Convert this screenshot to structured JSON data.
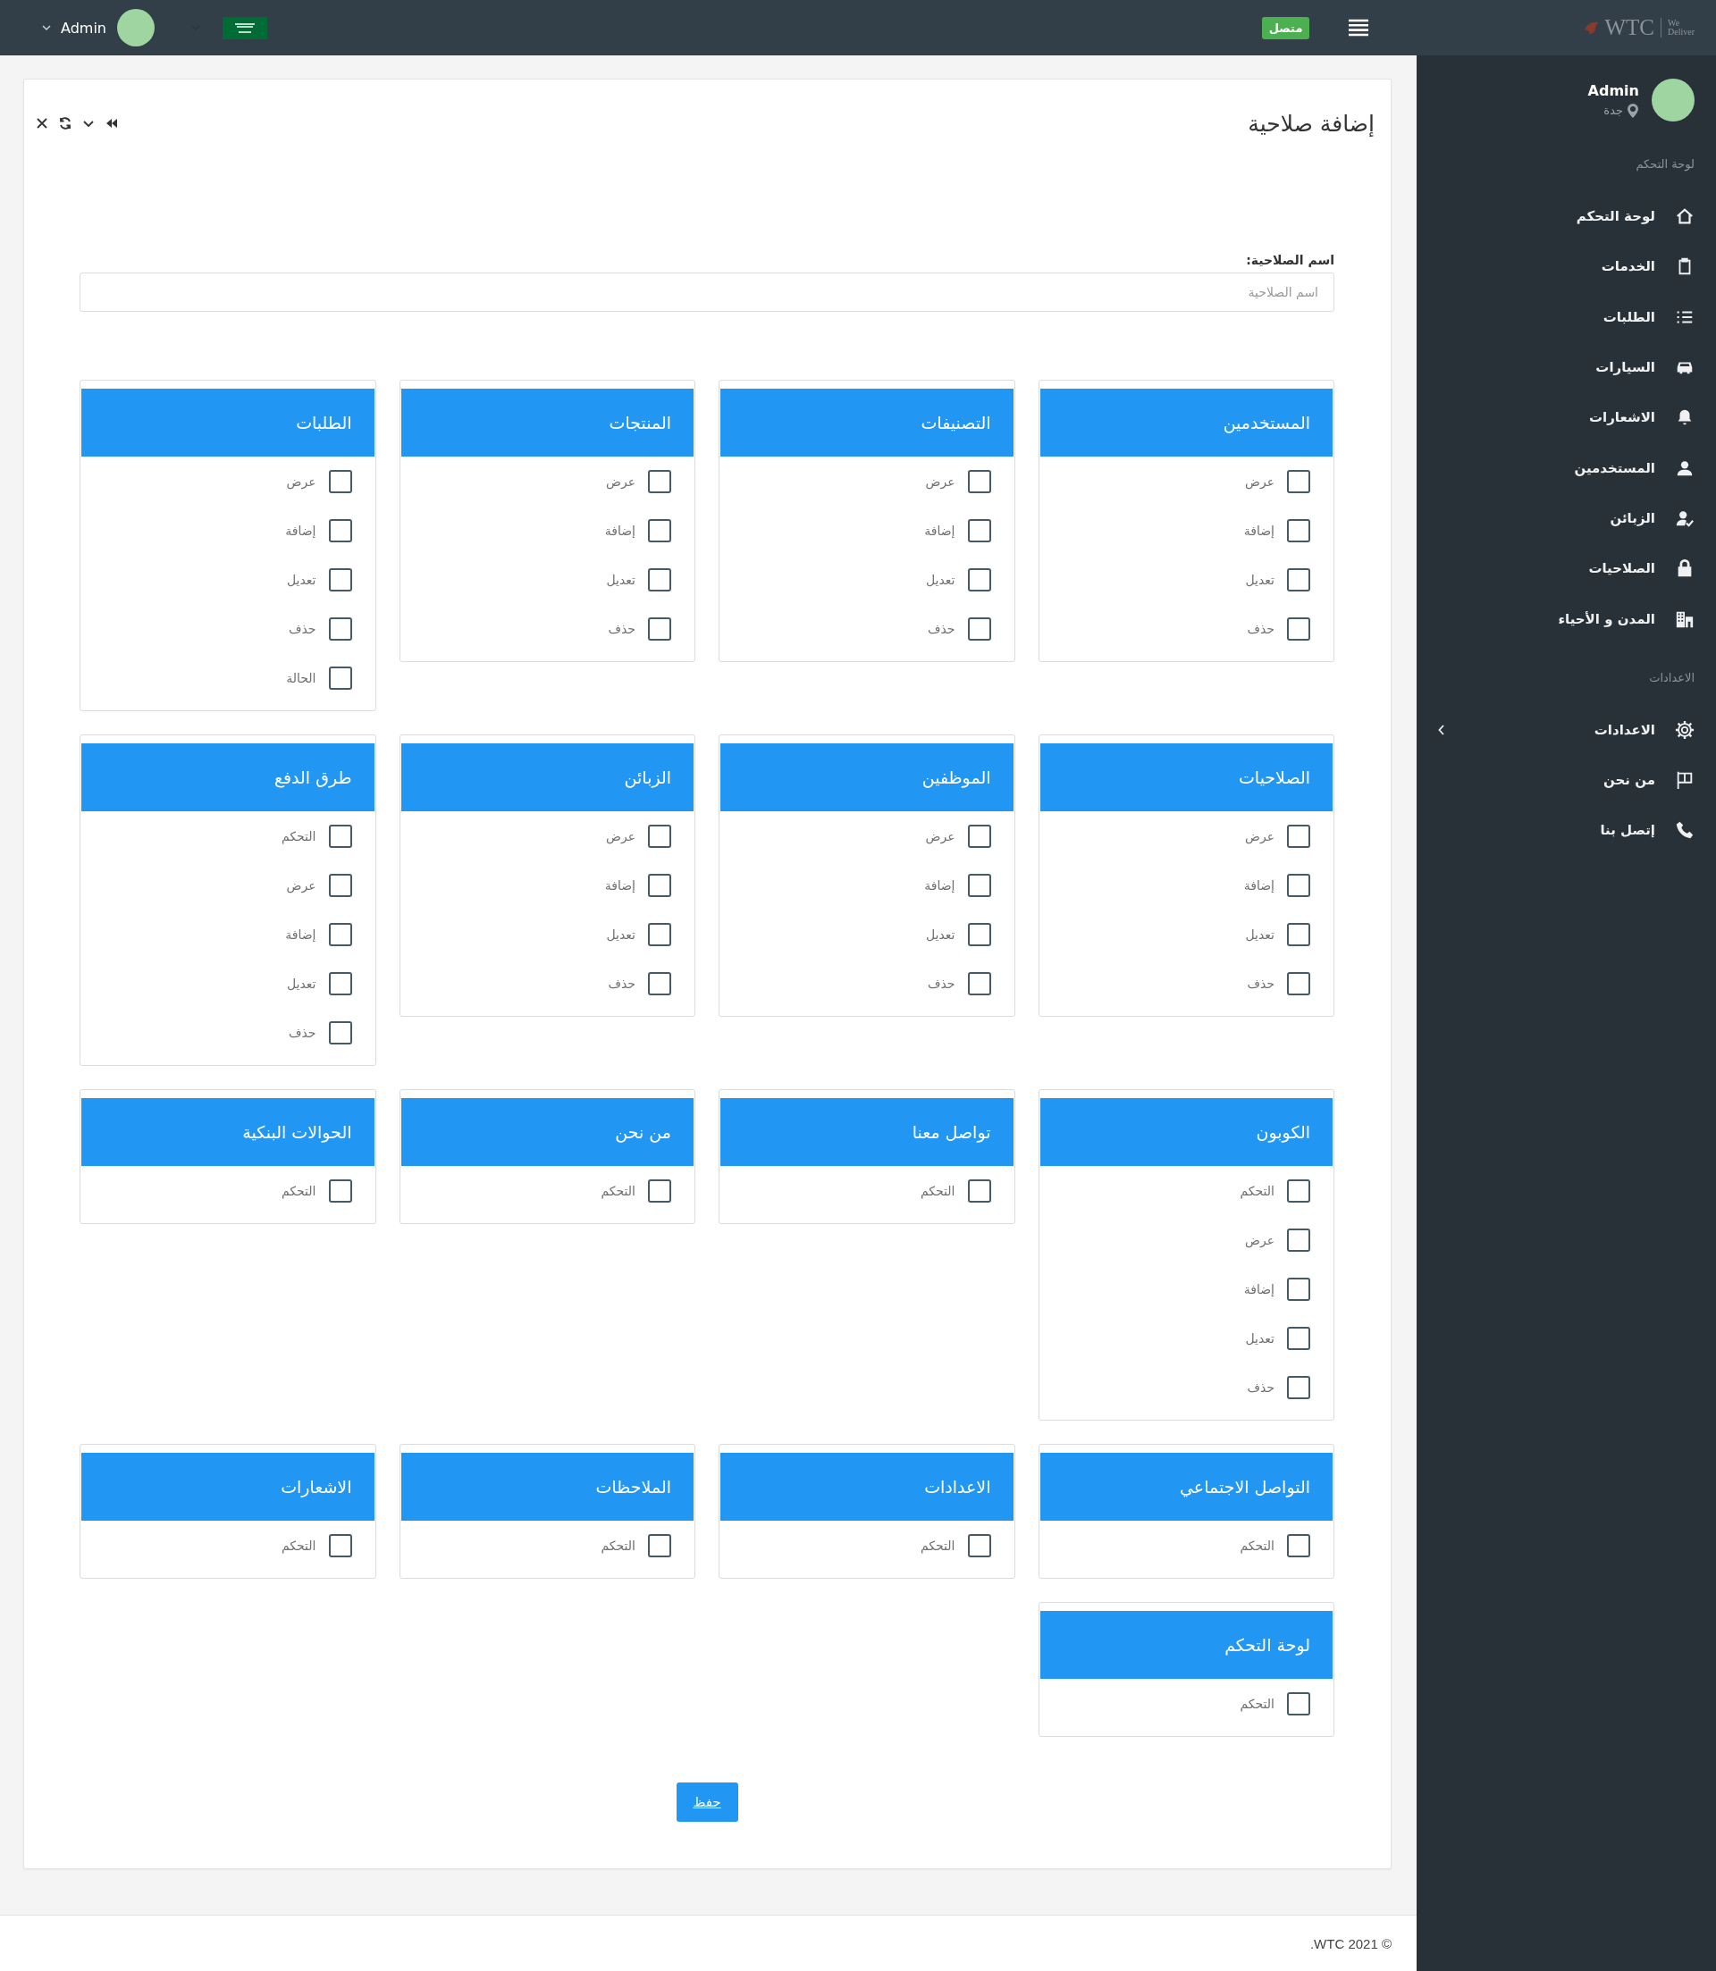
{
  "topbar": {
    "logo": {
      "name": "WTC",
      "tagline_top": "We",
      "tagline_bottom": "Deliver"
    },
    "status_badge": "متصل",
    "user": {
      "name": "Admin"
    }
  },
  "sidebar": {
    "user": {
      "name": "Admin",
      "location": "جدة"
    },
    "sections": [
      {
        "title": "لوحة التحكم",
        "items": [
          {
            "label": "لوحة التحكم",
            "submenu": false
          },
          {
            "label": "الخدمات",
            "submenu": false
          },
          {
            "label": "الطلبات",
            "submenu": false
          },
          {
            "label": "السيارات",
            "submenu": false
          },
          {
            "label": "الاشعارات",
            "submenu": false
          },
          {
            "label": "المستخدمين",
            "submenu": false
          },
          {
            "label": "الزبائن",
            "submenu": false
          },
          {
            "label": "الصلاحيات",
            "submenu": false
          },
          {
            "label": "المدن و الأحياء",
            "submenu": false
          }
        ]
      },
      {
        "title": "الاعدادات",
        "items": [
          {
            "label": "الاعدادات",
            "submenu": true
          },
          {
            "label": "من نحن",
            "submenu": false
          },
          {
            "label": "إتصل بنا",
            "submenu": false
          }
        ]
      }
    ]
  },
  "page": {
    "title": "إضافة صلاحية",
    "field": {
      "label": "اسم الصلاحية:",
      "placeholder": "اسم الصلاحية"
    },
    "groups": [
      {
        "title": "المستخدمين",
        "options": [
          {
            "label": "عرض",
            "checked": false
          },
          {
            "label": "إضافة",
            "checked": false
          },
          {
            "label": "تعديل",
            "checked": false
          },
          {
            "label": "حذف",
            "checked": false
          }
        ]
      },
      {
        "title": "التصنيفات",
        "options": [
          {
            "label": "عرض",
            "checked": false
          },
          {
            "label": "إضافة",
            "checked": false
          },
          {
            "label": "تعديل",
            "checked": false
          },
          {
            "label": "حذف",
            "checked": false
          }
        ]
      },
      {
        "title": "المنتجات",
        "options": [
          {
            "label": "عرض",
            "checked": false
          },
          {
            "label": "إضافة",
            "checked": false
          },
          {
            "label": "تعديل",
            "checked": false
          },
          {
            "label": "حذف",
            "checked": false
          }
        ]
      },
      {
        "title": "الطلبات",
        "options": [
          {
            "label": "عرض",
            "checked": false
          },
          {
            "label": "إضافة",
            "checked": false
          },
          {
            "label": "تعديل",
            "checked": false
          },
          {
            "label": "حذف",
            "checked": false
          },
          {
            "label": "الحالة",
            "checked": false
          }
        ]
      },
      {
        "title": "الصلاحيات",
        "options": [
          {
            "label": "عرض",
            "checked": false
          },
          {
            "label": "إضافة",
            "checked": false
          },
          {
            "label": "تعديل",
            "checked": false
          },
          {
            "label": "حذف",
            "checked": false
          }
        ]
      },
      {
        "title": "الموظفين",
        "options": [
          {
            "label": "عرض",
            "checked": false
          },
          {
            "label": "إضافة",
            "checked": false
          },
          {
            "label": "تعديل",
            "checked": false
          },
          {
            "label": "حذف",
            "checked": false
          }
        ]
      },
      {
        "title": "الزبائن",
        "options": [
          {
            "label": "عرض",
            "checked": false
          },
          {
            "label": "إضافة",
            "checked": false
          },
          {
            "label": "تعديل",
            "checked": false
          },
          {
            "label": "حذف",
            "checked": false
          }
        ]
      },
      {
        "title": "طرق الدفع",
        "options": [
          {
            "label": "التحكم",
            "checked": false
          },
          {
            "label": "عرض",
            "checked": false
          },
          {
            "label": "إضافة",
            "checked": false
          },
          {
            "label": "تعديل",
            "checked": false
          },
          {
            "label": "حذف",
            "checked": false
          }
        ]
      },
      {
        "title": "الكوبون",
        "options": [
          {
            "label": "التحكم",
            "checked": false
          },
          {
            "label": "عرض",
            "checked": false
          },
          {
            "label": "إضافة",
            "checked": false
          },
          {
            "label": "تعديل",
            "checked": false
          },
          {
            "label": "حذف",
            "checked": false
          }
        ]
      },
      {
        "title": "تواصل معنا",
        "options": [
          {
            "label": "التحكم",
            "checked": false
          }
        ]
      },
      {
        "title": "من نحن",
        "options": [
          {
            "label": "التحكم",
            "checked": false
          }
        ]
      },
      {
        "title": "الحوالات البنكية",
        "options": [
          {
            "label": "التحكم",
            "checked": false
          }
        ]
      },
      {
        "title": "التواصل الاجتماعي",
        "options": [
          {
            "label": "التحكم",
            "checked": false
          }
        ]
      },
      {
        "title": "الاعدادات",
        "options": [
          {
            "label": "التحكم",
            "checked": false
          }
        ]
      },
      {
        "title": "الملاحظات",
        "options": [
          {
            "label": "التحكم",
            "checked": false
          }
        ]
      },
      {
        "title": "الاشعارات",
        "options": [
          {
            "label": "التحكم",
            "checked": false
          }
        ]
      },
      {
        "title": "لوحة التحكم",
        "options": [
          {
            "label": "التحكم",
            "checked": false
          }
        ]
      }
    ],
    "save_button": "حفظ"
  },
  "footer": {
    "copyright": ".WTC 2021 ©"
  }
}
